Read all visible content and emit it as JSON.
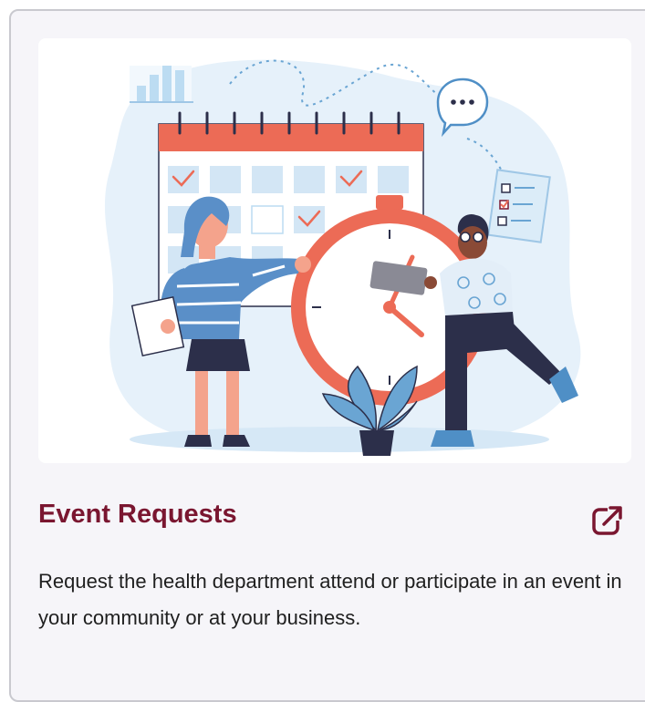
{
  "card": {
    "title": "Event Requests",
    "description": "Request the health department attend or participate in an event in your community or at your business.",
    "link_icon": "external-link-icon",
    "illustration": "calendar-stopwatch-people-illustration"
  },
  "colors": {
    "title": "#7a1630",
    "accent_coral": "#ec6b56",
    "light_blue": "#d9ecf8",
    "navy": "#2c2f4a"
  }
}
